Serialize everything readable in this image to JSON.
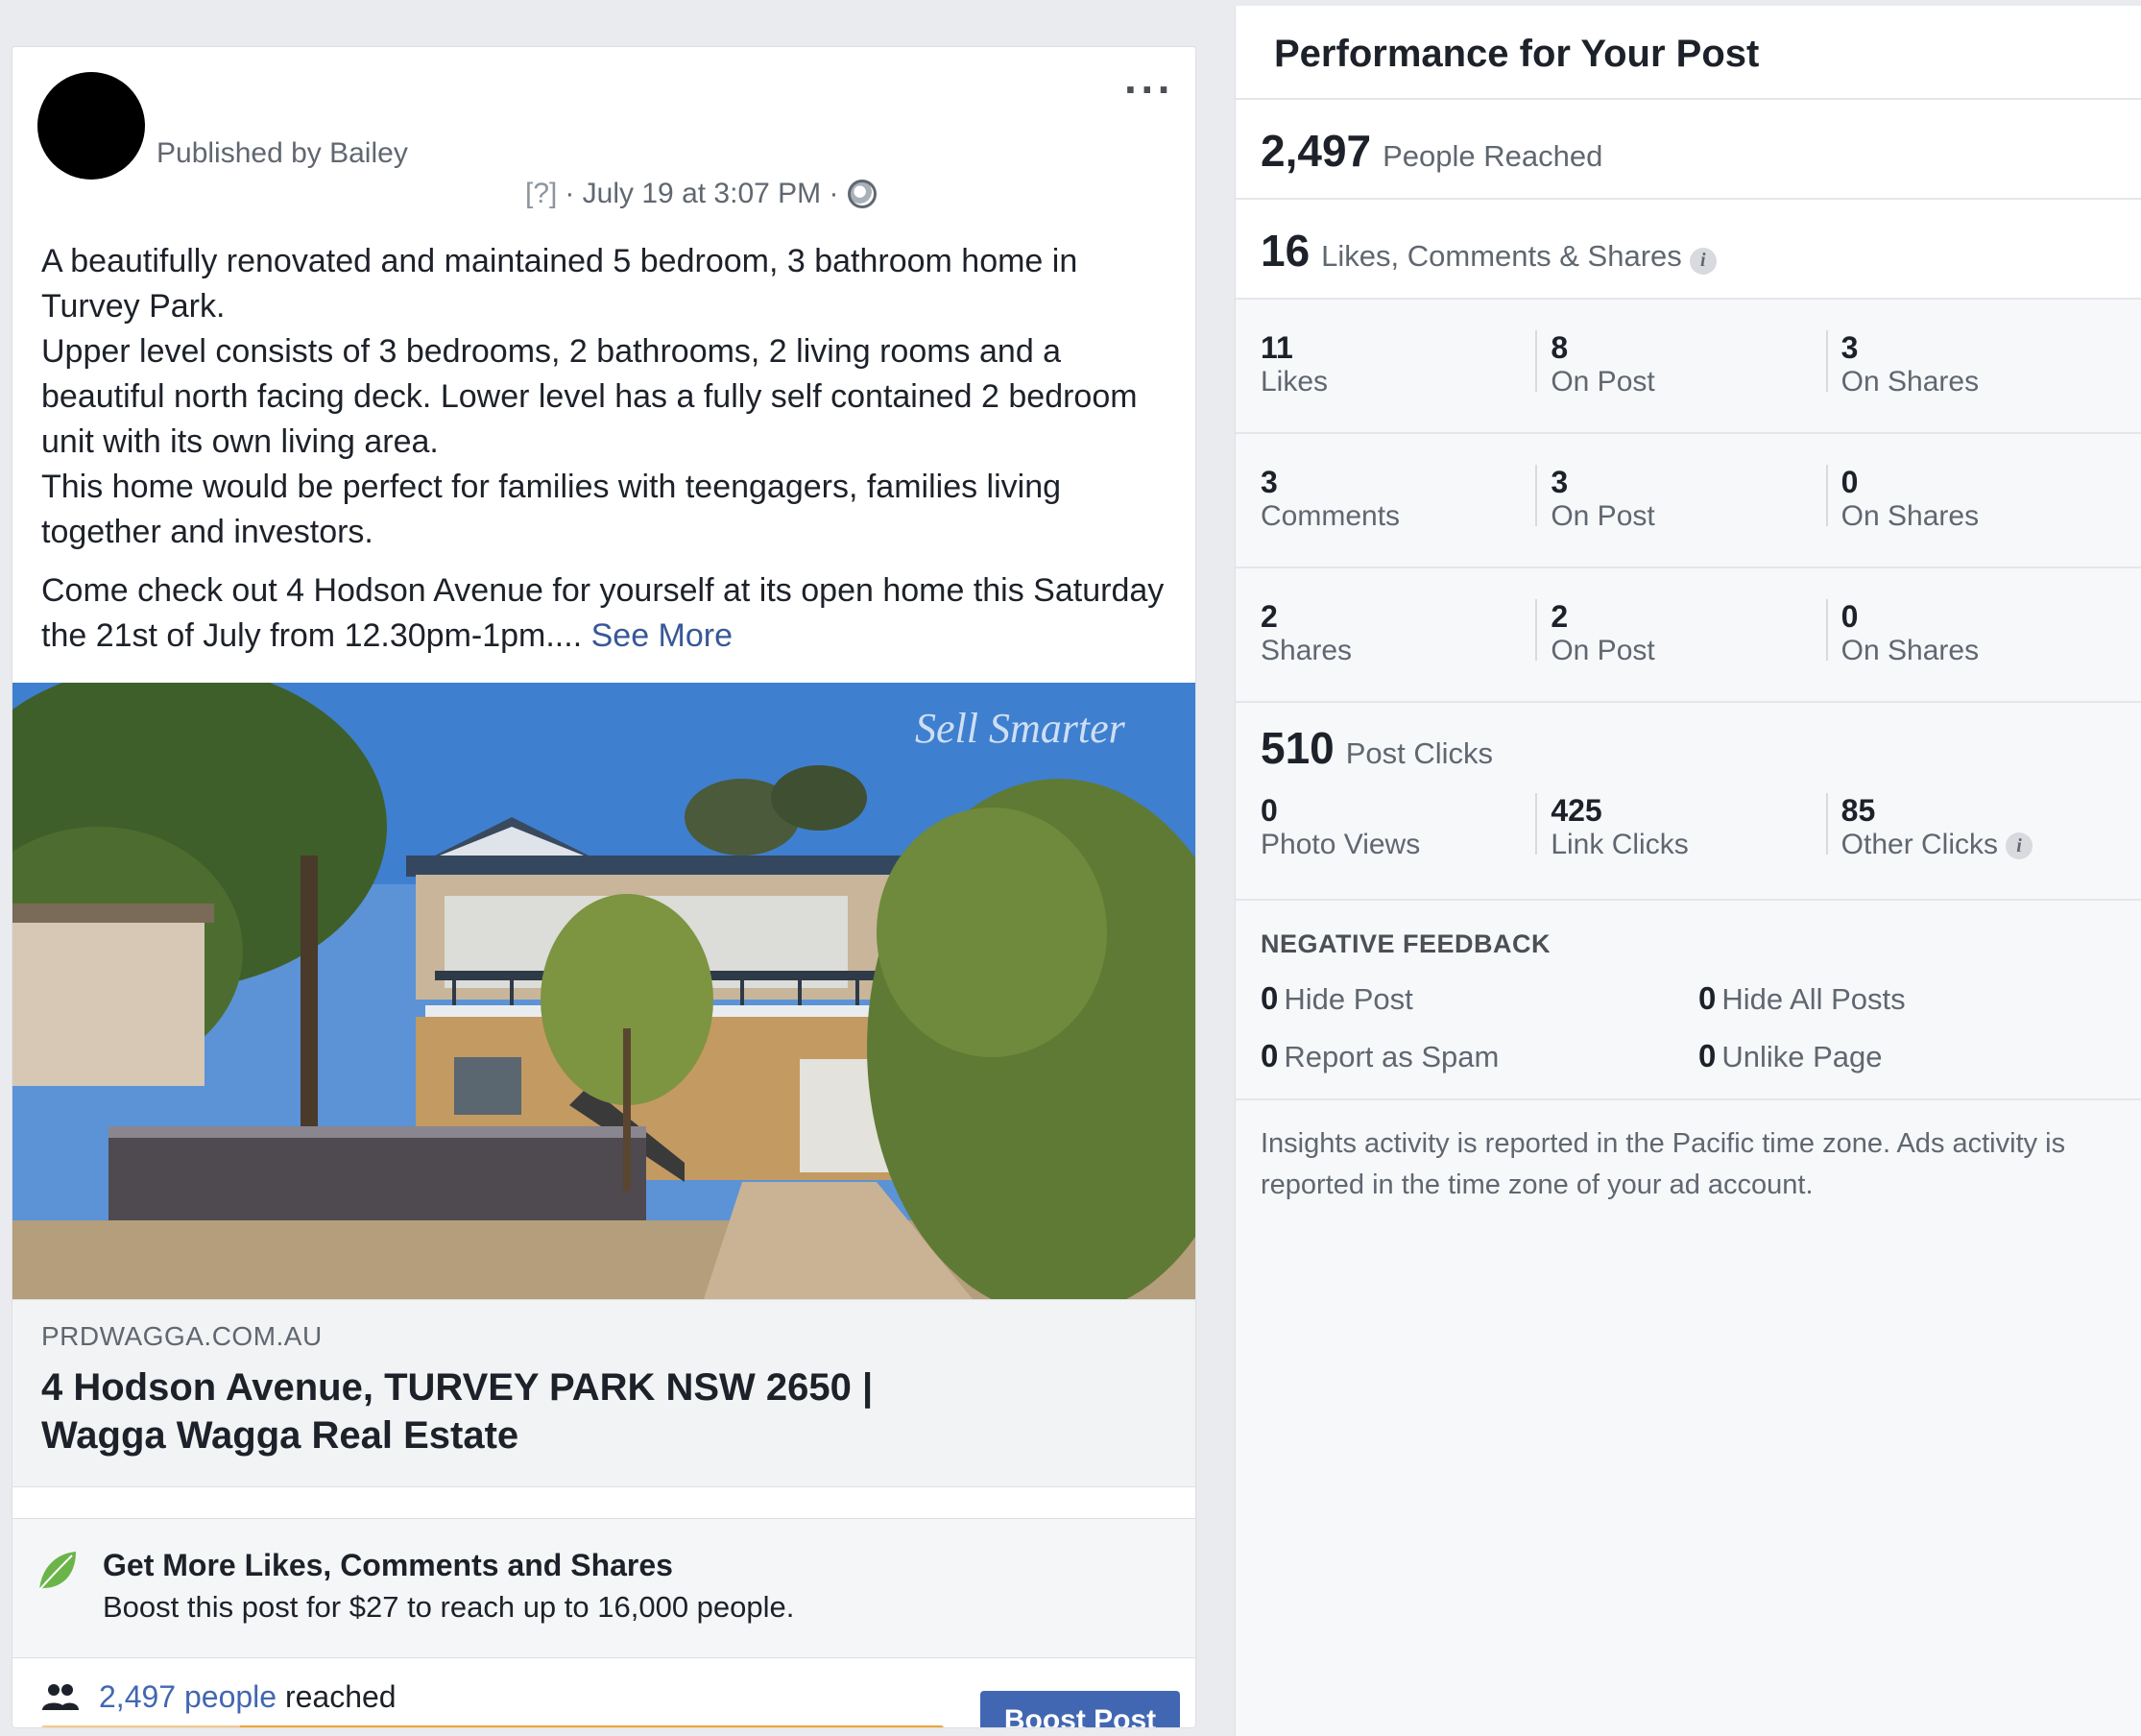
{
  "post": {
    "publisher": "Published by Bailey",
    "meta_help": "[?]",
    "meta_date": "· July 19 at 3:07 PM ·",
    "paragraphs": [
      "A beautifully renovated and maintained 5 bedroom, 3 bathroom home in Turvey Park.",
      "Upper level consists of 3 bedrooms, 2 bathrooms, 2 living rooms and a beautiful north facing deck. Lower level has a fully self contained 2 bedroom unit with its own living area.",
      "This home would be perfect for families with teengagers, families living together and investors."
    ],
    "last_paragraph": "Come check out 4 Hodson Avenue for yourself at its open home this Saturday the 21st of July from 12.30pm-1pm....",
    "see_more": "See More",
    "photo_watermark": "Sell Smarter",
    "link_domain": "PRDWAGGA.COM.AU",
    "link_title_line1": "4 Hodson Avenue, TURVEY PARK NSW 2650 |",
    "link_title_line2": "Wagga Wagga Real Estate",
    "promo_title": "Get More Likes, Comments and Shares",
    "promo_sub": "Boost this post for $27 to reach up to 16,000 people.",
    "reach_link": "2,497 people",
    "reach_suffix": " reached",
    "reach_progress_unfilled_fraction": 0.22,
    "boost_button": "Boost Post",
    "icons": {
      "more": "more-options-icon",
      "globe": "globe-icon",
      "leaf": "leaf-icon",
      "people": "people-icon"
    }
  },
  "performance": {
    "title": "Performance for Your Post",
    "reached_num": "2,497",
    "reached_label": "People Reached",
    "engagement_num": "16",
    "engagement_label": "Likes, Comments & Shares",
    "rows": [
      {
        "c1n": "11",
        "c1t": "Likes",
        "c2n": "8",
        "c2t": "On Post",
        "c3n": "3",
        "c3t": "On Shares"
      },
      {
        "c1n": "3",
        "c1t": "Comments",
        "c2n": "3",
        "c2t": "On Post",
        "c3n": "0",
        "c3t": "On Shares"
      },
      {
        "c1n": "2",
        "c1t": "Shares",
        "c2n": "2",
        "c2t": "On Post",
        "c3n": "0",
        "c3t": "On Shares"
      }
    ],
    "clicks_num": "510",
    "clicks_label": "Post Clicks",
    "clicks": {
      "c1n": "0",
      "c1t": "Photo Views",
      "c2n": "425",
      "c2t": "Link Clicks",
      "c3n": "85",
      "c3t": "Other Clicks"
    },
    "negative_title": "NEGATIVE FEEDBACK",
    "negative": [
      {
        "n": "0",
        "t": "Hide Post"
      },
      {
        "n": "0",
        "t": "Hide All Posts"
      },
      {
        "n": "0",
        "t": "Report as Spam"
      },
      {
        "n": "0",
        "t": "Unlike Page"
      }
    ],
    "footnote": "Insights activity is reported in the Pacific time zone. Ads activity is reported in the time zone of your ad account."
  },
  "colors": {
    "link_blue": "#385898",
    "button_blue": "#4267b2",
    "progress_fill": "#f0a434",
    "progress_track": "#f7c988",
    "leaf_green": "#6bb44a"
  }
}
